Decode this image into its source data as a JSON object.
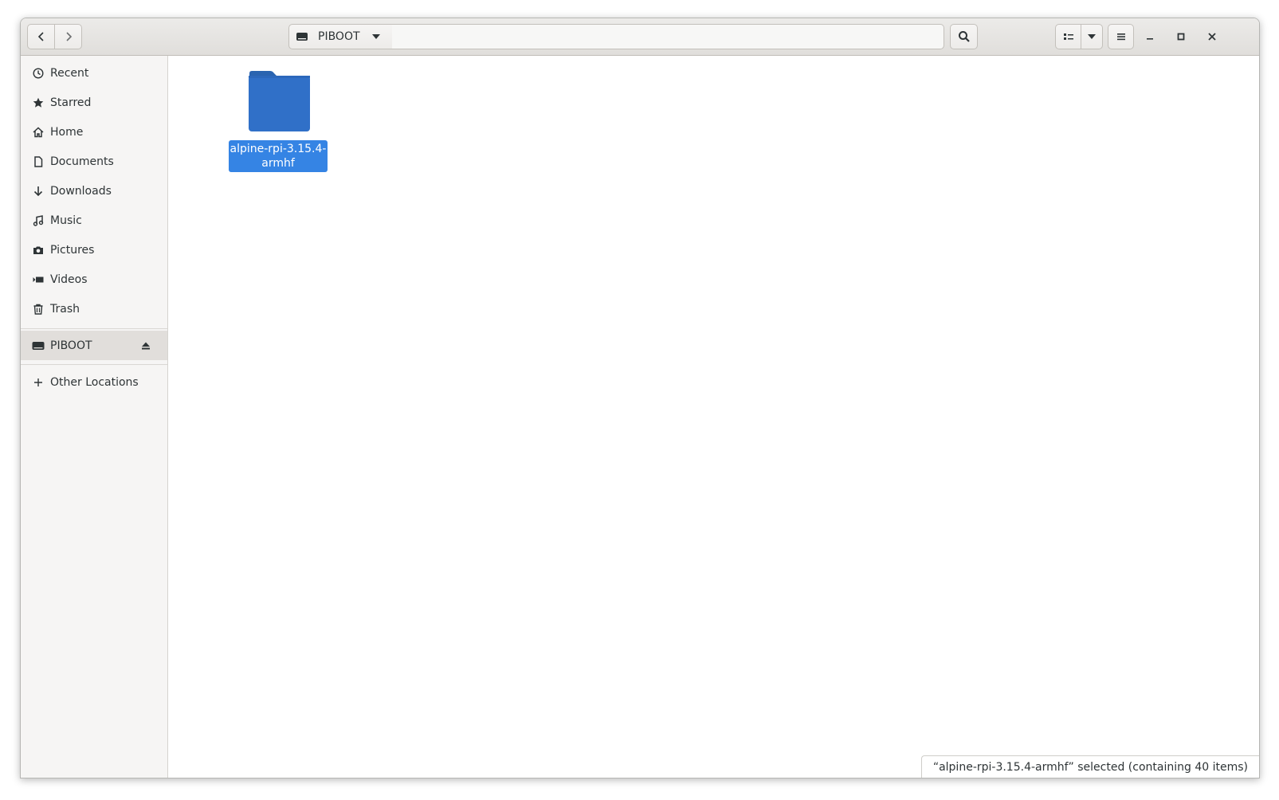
{
  "header": {
    "location_label": "PIBOOT",
    "path_entry_value": ""
  },
  "icons": {
    "back": "chevron-left-icon",
    "forward": "chevron-right-icon",
    "drive": "drive-icon",
    "location_dropdown": "caret-down-icon",
    "search": "search-icon",
    "view_list": "list-view-icon",
    "view_options": "caret-down-icon",
    "menu": "hamburger-menu-icon",
    "minimize": "minimize-icon",
    "maximize": "maximize-icon",
    "close": "close-icon"
  },
  "sidebar": {
    "items": [
      {
        "label": "Recent",
        "icon": "clock-icon"
      },
      {
        "label": "Starred",
        "icon": "star-icon"
      },
      {
        "label": "Home",
        "icon": "home-icon"
      },
      {
        "label": "Documents",
        "icon": "document-icon"
      },
      {
        "label": "Downloads",
        "icon": "download-icon"
      },
      {
        "label": "Music",
        "icon": "music-icon"
      },
      {
        "label": "Pictures",
        "icon": "camera-icon"
      },
      {
        "label": "Videos",
        "icon": "video-icon"
      },
      {
        "label": "Trash",
        "icon": "trash-icon"
      }
    ],
    "devices": [
      {
        "label": "PIBOOT",
        "icon": "drive-icon",
        "action_icon": "eject-icon",
        "active": true
      }
    ],
    "other_locations": {
      "label": "Other Locations",
      "icon": "plus-icon"
    }
  },
  "content": {
    "items": [
      {
        "name": "alpine-rpi-3.15.4-armhf",
        "name_line1": "alpine-rpi-3.15.4-",
        "name_line2": "armhf",
        "type": "folder",
        "selected": true
      }
    ]
  },
  "status": {
    "text": "“alpine-rpi-3.15.4-armhf” selected  (containing 40 items)"
  },
  "colors": {
    "accent": "#3584e4",
    "folder": "#3070c8",
    "headerbar": "#e6e4e1",
    "sidebar": "#f6f5f4"
  }
}
